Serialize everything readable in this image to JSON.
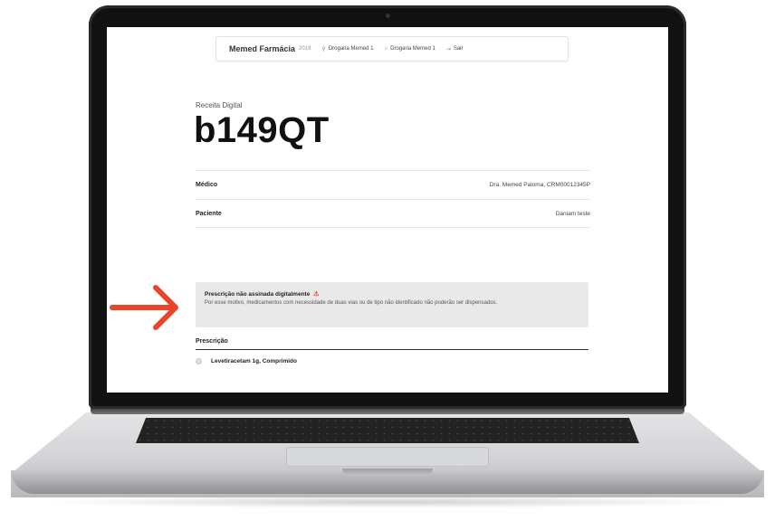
{
  "topbar": {
    "brand": "Memed Farmácia",
    "brand_year": "2019",
    "nav": [
      {
        "icon": "user-icon",
        "label": "Drogaria Memed 1"
      },
      {
        "icon": "store-icon",
        "label": "Drogaria Memed 1"
      },
      {
        "icon": "logout-icon",
        "label": "Sair"
      }
    ]
  },
  "prescription": {
    "eyebrow": "Receita Digital",
    "code": "b149QT",
    "rows": [
      {
        "label": "Médico",
        "value": "Dra. Memed Paloma, CRM00012345P"
      },
      {
        "label": "Paciente",
        "value": "Daniam teste"
      }
    ]
  },
  "alert": {
    "title": "Prescrição não assinada digitalmente",
    "icon": "warning-icon",
    "body": "Por esse motivo, medicamentos com necessidade de duas vias ou de tipo não identificado não poderão ser dispensados."
  },
  "prescription_section": {
    "title": "Prescrição",
    "items": [
      {
        "label": "Levetiracetam 1g, Comprimido"
      }
    ]
  },
  "colors": {
    "accent_arrow": "#e8452c",
    "alert_bg": "#e9e9e9"
  }
}
